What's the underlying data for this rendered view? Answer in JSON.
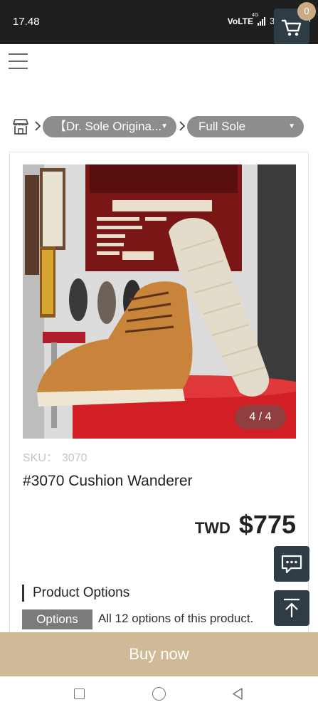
{
  "status_bar": {
    "time": "17.48",
    "network": "VoLTE",
    "signal_tag": "4G",
    "battery_percent": "32%",
    "battery_level": 0.32
  },
  "header": {
    "menu_icon": "hamburger-menu-icon",
    "cart_icon": "shopping-cart-icon",
    "cart_count": "0",
    "accent_color": "#2f3c46",
    "badge_color": "#c9ab86"
  },
  "breadcrumb": {
    "home_icon": "store-icon",
    "category": "【Dr. Sole Origina...",
    "subcategory": "Full Sole"
  },
  "product": {
    "image_counter": "4 / 4",
    "sku_label": "SKU：",
    "sku_value": "3070",
    "title": "#3070 Cushion Wanderer",
    "currency": "TWD",
    "price": "$775",
    "options_heading": "Product Options",
    "options_tag": "Options",
    "options_summary": "All 12 options of this product."
  },
  "floating": {
    "chat_icon": "chat-icon",
    "back_to_top_icon": "arrow-up-icon"
  },
  "footer": {
    "buy_label": "Buy now",
    "buy_color": "#cfb996"
  },
  "system_nav": {
    "recent_icon": "square-icon",
    "home_icon": "circle-icon",
    "back_icon": "triangle-back-icon"
  }
}
